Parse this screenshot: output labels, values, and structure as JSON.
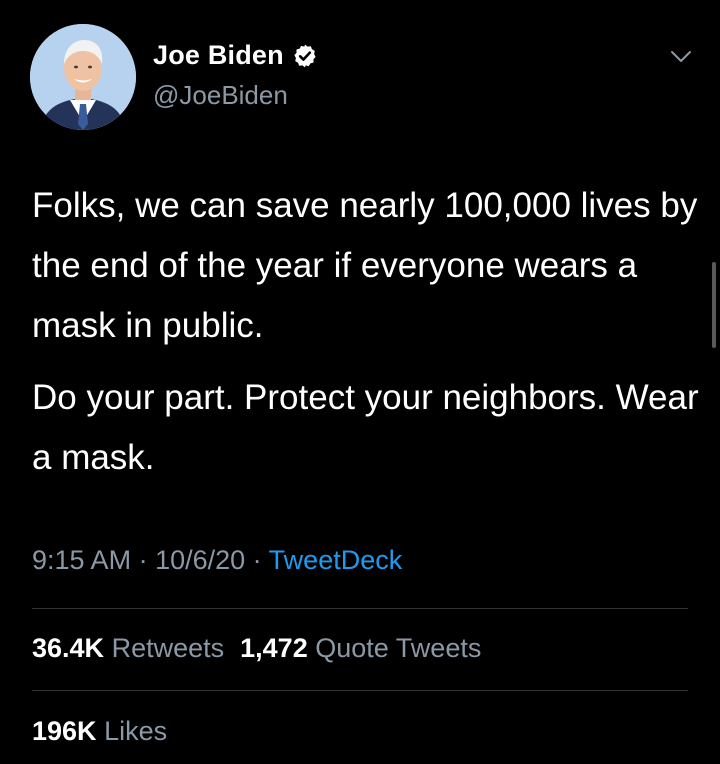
{
  "user": {
    "name": "Joe Biden",
    "handle": "@JoeBiden",
    "verified": true
  },
  "tweet": {
    "paragraphs": [
      "Folks, we can save nearly 100,000 lives by the end of the year if everyone wears a mask in public.",
      "Do your part. Protect your neighbors. Wear a mask."
    ]
  },
  "meta": {
    "time": "9:15 AM",
    "sep1": " · ",
    "date": "10/6/20",
    "sep2": " · ",
    "source": "TweetDeck"
  },
  "stats": {
    "retweets_count": "36.4K",
    "retweets_label": "Retweets",
    "quotes_count": "1,472",
    "quotes_label": "Quote Tweets",
    "likes_count": "196K",
    "likes_label": "Likes"
  },
  "colors": {
    "background": "#000000",
    "secondary_text": "#8b98a5",
    "link": "#1d9bf0",
    "divider": "#2f3336"
  },
  "icons": {
    "verified": "verified-badge-icon",
    "menu": "chevron-down-icon"
  }
}
